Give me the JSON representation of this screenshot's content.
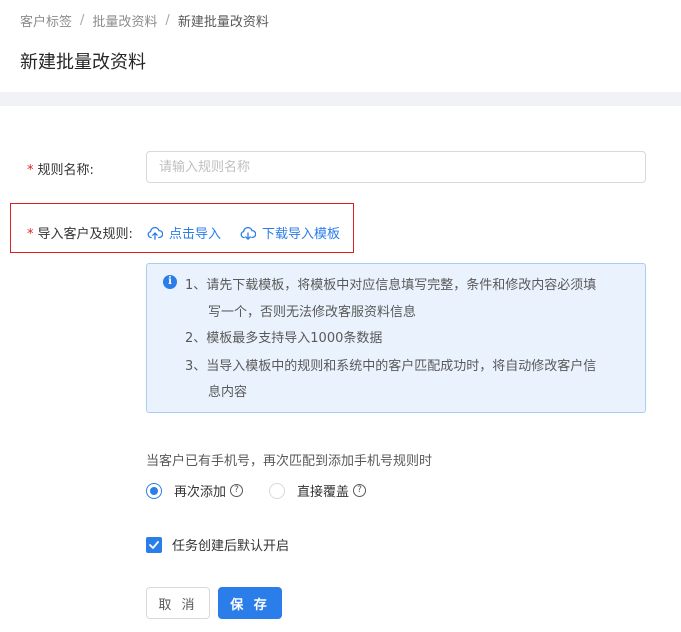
{
  "breadcrumb": {
    "items": [
      "客户标签",
      "批量改资料",
      "新建批量改资料"
    ],
    "separator": "/"
  },
  "page": {
    "title": "新建批量改资料"
  },
  "form": {
    "required_mark": "*",
    "rule_name": {
      "label": "规则名称:",
      "placeholder": "请输入规则名称",
      "value": ""
    },
    "import": {
      "label": "导入客户及规则:",
      "import_link": "点击导入",
      "template_link": "下载导入模板",
      "icon": "cloud-upload-icon"
    },
    "notice": {
      "lines": [
        "1、请先下载模板，将模板中对应信息填写完整，条件和修改内容必须填",
        "写一个，否则无法修改客服资料信息",
        "2、模板最多支持导入1000条数据",
        "3、当导入模板中的规则和系统中的客户匹配成功时，将自动修改客户信",
        "息内容"
      ]
    },
    "phone_rule": {
      "question": "当客户已有手机号，再次匹配到添加手机号规则时",
      "options": [
        {
          "label": "再次添加",
          "checked": true
        },
        {
          "label": "直接覆盖",
          "checked": false
        }
      ]
    },
    "auto_enable": {
      "label": "任务创建后默认开启",
      "checked": true
    },
    "buttons": {
      "cancel": "取 消",
      "save": "保 存"
    }
  },
  "colors": {
    "primary": "#2b7de9",
    "required": "#e02020",
    "highlight_border": "#e02020",
    "notice_bg": "#eaf3fd"
  }
}
